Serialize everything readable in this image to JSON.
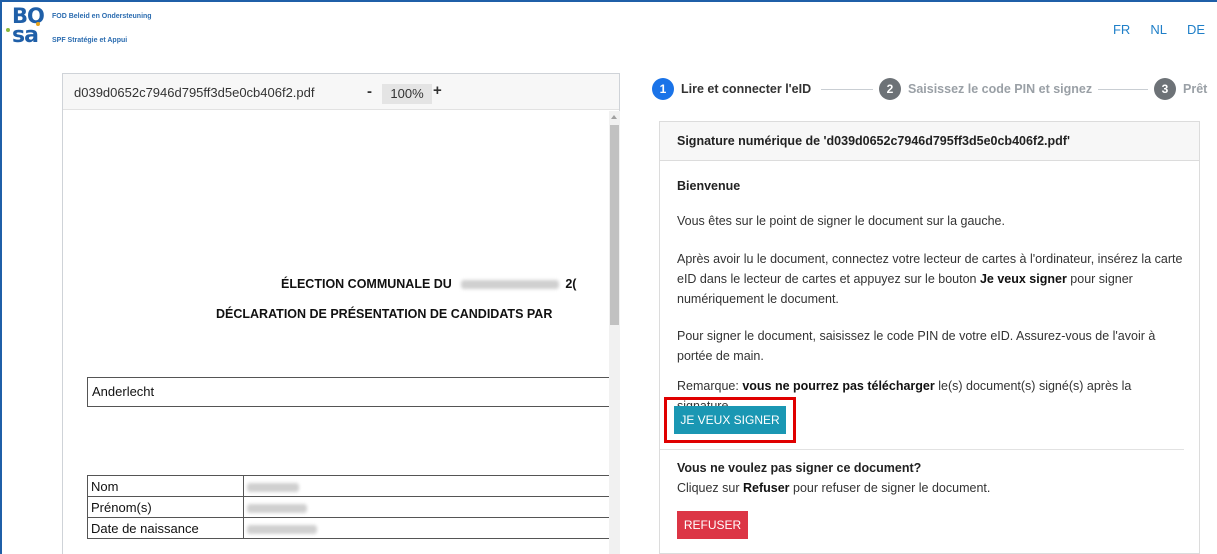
{
  "header": {
    "logo_top": "BO",
    "logo_bottom": "sa",
    "org_nl": "FOD Beleid en Ondersteuning",
    "org_fr": "SPF Stratégie et Appui",
    "languages": [
      "FR",
      "NL",
      "DE"
    ]
  },
  "viewer": {
    "filename": "d039d0652c7946d795ff3d5e0cb406f2.pdf",
    "zoom_minus": "-",
    "zoom_level": "100%",
    "zoom_plus": "+",
    "doc_title_1": "ÉLECTION COMMUNALE DU",
    "doc_title_1_end": "2(",
    "doc_title_2": "DÉCLARATION DE PRÉSENTATION DE CANDIDATS PAR",
    "commune": "Anderlecht",
    "table_labels": [
      "Nom",
      "Prénom(s)",
      "Date de naissance"
    ]
  },
  "stepper": {
    "steps": [
      {
        "num": "1",
        "label": "Lire et connecter l'eID"
      },
      {
        "num": "2",
        "label": "Saisissez le code PIN et signez"
      },
      {
        "num": "3",
        "label": "Prêt"
      }
    ]
  },
  "card": {
    "header": "Signature numérique de 'd039d0652c7946d795ff3d5e0cb406f2.pdf'",
    "welcome": "Bienvenue",
    "p1": "Vous êtes sur le point de signer le document sur la gauche.",
    "p2_a": "Après avoir lu le document, connectez votre lecteur de cartes à l'ordinateur, insérez la carte eID dans le lecteur de cartes et appuyez sur le bouton ",
    "p2_b": "Je veux signer",
    "p2_c": " pour signer numériquement le document.",
    "p3": "Pour signer le document, saisissez le code PIN de votre eID. Assurez-vous de l'avoir à portée de main.",
    "p4_a": "Remarque: ",
    "p4_b": "vous ne pourrez pas télécharger",
    "p4_c": " le(s) document(s) signé(s) après la signature.",
    "sign_button": "JE VEUX SIGNER",
    "q_title": "Vous ne voulez pas signer ce document?",
    "q_a": "Cliquez sur ",
    "q_b": "Refuser",
    "q_c": " pour refuser de signer le document.",
    "refuse_button": "REFUSER"
  },
  "colors": {
    "brand_blue": "#1f5fa8",
    "step_active": "#1a73e8",
    "sign_button": "#1a97b3",
    "refuse_button": "#dc3545",
    "highlight": "#e00000"
  }
}
